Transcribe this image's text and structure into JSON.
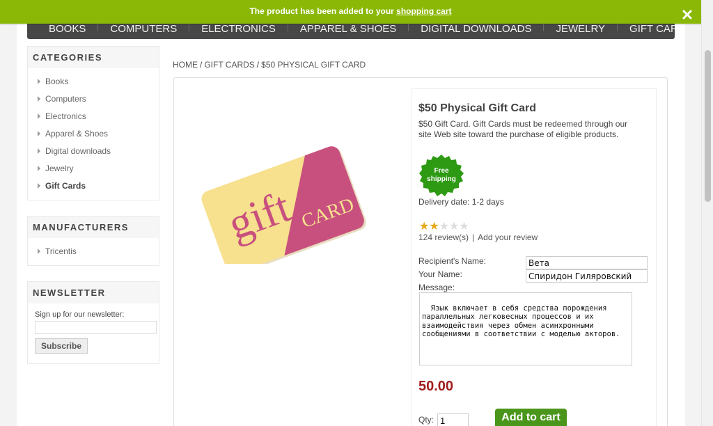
{
  "notification": {
    "text": "The product has been added to your",
    "link": "shopping cart",
    "close_icon": "close-icon"
  },
  "top_menu": {
    "items": [
      "Books",
      "Computers",
      "Electronics",
      "Apparel & Shoes",
      "Digital downloads",
      "Jewelry",
      "Gift Cards"
    ]
  },
  "categories": {
    "title": "Categories",
    "items": [
      "Books",
      "Computers",
      "Electronics",
      "Apparel & Shoes",
      "Digital downloads",
      "Jewelry",
      "Gift Cards"
    ],
    "active": "Gift Cards"
  },
  "manufacturers": {
    "title": "Manufacturers",
    "items": [
      "Tricentis"
    ]
  },
  "newsletter": {
    "title": "Newsletter",
    "label": "Sign up for our newsletter:",
    "input_value": "",
    "button": "Subscribe"
  },
  "breadcrumb": {
    "items": [
      "Home",
      "Gift Cards",
      "$50 Physical Gift Card"
    ],
    "separator": "/"
  },
  "product": {
    "name": "$50 Physical Gift Card",
    "description": "$50 Gift Card. Gift Cards must be redeemed through our site Web site toward the purchase of eligible products.",
    "image_text": {
      "gift": "gift",
      "card": "CARD"
    },
    "free_shipping": {
      "line1": "Free",
      "line2": "shipping"
    },
    "delivery": "Delivery date: 1-2 days",
    "rating": {
      "value": 2,
      "max": 5
    },
    "reviews": {
      "count_text": "124 review(s)",
      "add_text": "Add your review",
      "divider": "|"
    },
    "form": {
      "recipient_label": "Recipient's Name:",
      "recipient_value": "Вета",
      "your_name_label": "Your Name:",
      "your_name_value": "Спиридон Гиляровский",
      "message_label": "Message:",
      "message_value": "Язык включает в себя средства порождения\nпараллельных легковесных процессов и их\nвзаимодействия через обмен асинхронными\nсообщениями в соответствии с моделью акторов."
    },
    "price": "50.00",
    "qty_label": "Qty:",
    "qty_value": "1",
    "add_to_cart": "Add to cart"
  },
  "colors": {
    "notify_bg": "#8bb806",
    "menu_bg": "#474747",
    "price": "#a01c1c",
    "add_button": "#4a961b",
    "free_ship_badge": "#2e9a14",
    "star_filled": "#e5a716",
    "star_empty": "#dddddd"
  }
}
